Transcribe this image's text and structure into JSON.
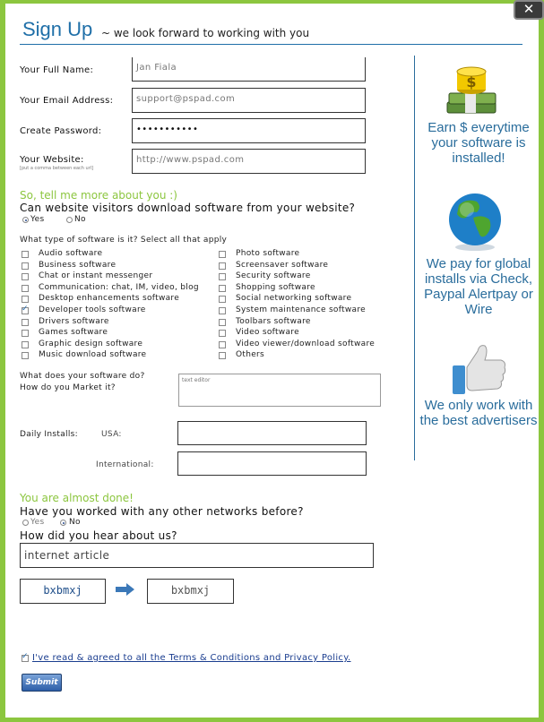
{
  "header": {
    "title": "Sign Up",
    "subtitle": "~ we look forward to working with you",
    "close_icon": "close-icon"
  },
  "contact": {
    "name_label": "Your Full Name:",
    "name_value": "Jan Fiala",
    "email_label": "Your Email Address:",
    "email_value": "support@pspad.com",
    "password_label": "Create Password:",
    "password_value": "•••••••••••",
    "website_label": "Your Website:",
    "website_hint": "[put a comma between each url]",
    "website_value": "http://www.pspad.com"
  },
  "software": {
    "section_title": "So, tell me more about you :)",
    "download_question": "Can website visitors download software from your website?",
    "yes_label": "Yes",
    "no_label": "No",
    "download_answer": "Yes",
    "types_question": "What type of software is it? Select all that apply",
    "types_left": [
      {
        "label": "Audio software",
        "checked": false
      },
      {
        "label": "Business software",
        "checked": false
      },
      {
        "label": "Chat or instant messenger",
        "checked": false
      },
      {
        "label": "Communication: chat, IM, video, blog",
        "checked": false
      },
      {
        "label": "Desktop enhancements software",
        "checked": false
      },
      {
        "label": "Developer tools software",
        "checked": true
      },
      {
        "label": "Drivers software",
        "checked": false
      },
      {
        "label": "Games software",
        "checked": false
      },
      {
        "label": "Graphic design software",
        "checked": false
      },
      {
        "label": "Music download software",
        "checked": false
      }
    ],
    "types_right": [
      {
        "label": "Photo software",
        "checked": false
      },
      {
        "label": "Screensaver software",
        "checked": false
      },
      {
        "label": "Security software",
        "checked": false
      },
      {
        "label": "Shopping software",
        "checked": false
      },
      {
        "label": "Social networking software",
        "checked": false
      },
      {
        "label": "System maintenance software",
        "checked": false
      },
      {
        "label": "Toolbars software",
        "checked": false
      },
      {
        "label": "Video software",
        "checked": false
      },
      {
        "label": "Video viewer/download software",
        "checked": false
      },
      {
        "label": "Others",
        "checked": false
      }
    ],
    "market_label_1": "What does your software do?",
    "market_label_2": "How do you Market it?",
    "market_placeholder": "text editor",
    "installs_label": "Daily Installs:",
    "usa_label": "USA:",
    "intl_label": "International:",
    "usa_value": "",
    "intl_value": ""
  },
  "finish": {
    "section_title": "You are almost done!",
    "networks_question": "Have you worked with any other networks before?",
    "yes_label": "Yes",
    "no_label": "No",
    "networks_answer": "No",
    "hear_question": "How did you hear about us?",
    "hear_value": "internet article",
    "captcha_code": "bxbmxj",
    "captcha_input": "bxbmxj",
    "terms_text": "I've read & agreed to all the Terms & Conditions and Privacy Policy.",
    "terms_checked": true,
    "submit_label": "Submit"
  },
  "promos": [
    {
      "text": "Earn $ everytime your software is installed!",
      "icon": "money-stack-icon"
    },
    {
      "text": "We pay for global installs via Check, Paypal Alertpay or Wire",
      "icon": "globe-icon"
    },
    {
      "text": "We only work with the best advertisers",
      "icon": "thumbs-up-icon"
    }
  ],
  "colors": {
    "accent_green": "#8cc63f",
    "title_blue": "#1f6fa8",
    "promo_blue": "#2a6d9c"
  }
}
